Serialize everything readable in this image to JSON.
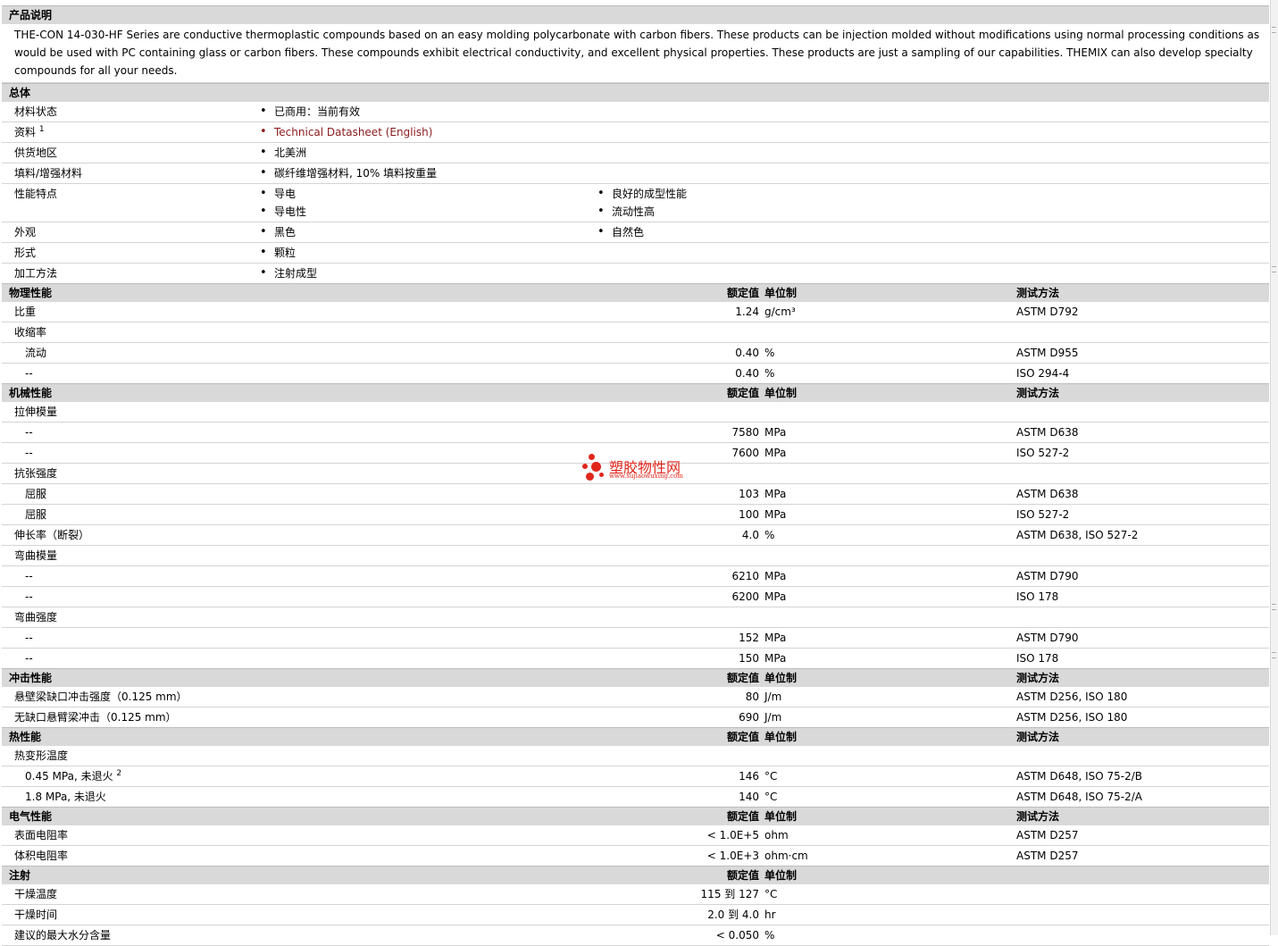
{
  "desc": {
    "title": "产品说明",
    "text": "THE-CON 14-030-HF Series are conductive thermoplastic compounds based on an easy molding polycarbonate with carbon fibers. These products can be injection molded without modifications using normal processing conditions as would be used with PC containing glass or carbon fibers. These compounds exhibit electrical conductivity, and excellent physical properties. These products are just a sampling of our capabilities. THEMIX can also develop specialty compounds for all your needs."
  },
  "general": {
    "title": "总体",
    "status_label": "材料状态",
    "status_value": "已商用：当前有效",
    "docs_label": "资料",
    "docs_sup": "1",
    "docs_link": "Technical Datasheet (English)",
    "region_label": "供货地区",
    "region_value": "北美洲",
    "filler_label": "填料/增强材料",
    "filler_value": "碳纤维增强材料, 10% 填料按重量",
    "features_label": "性能特点",
    "features": [
      "导电",
      "良好的成型性能",
      "导电性",
      "流动性高"
    ],
    "appearance_label": "外观",
    "appearance": [
      "黑色",
      "自然色"
    ],
    "form_label": "形式",
    "form_value": "颗粒",
    "process_label": "加工方法",
    "process_value": "注射成型"
  },
  "headers": {
    "value": "额定值",
    "unit": "单位制",
    "method": "测试方法"
  },
  "physical": {
    "title": "物理性能",
    "rows": [
      {
        "label": "比重",
        "value": "1.24",
        "unit": "g/cm³",
        "method": "ASTM D792"
      },
      {
        "label": "收缩率"
      },
      {
        "label": "流动",
        "value": "0.40",
        "unit": "%",
        "method": "ASTM D955"
      },
      {
        "label": "--",
        "value": "0.40",
        "unit": "%",
        "method": "ISO 294-4"
      }
    ]
  },
  "mechanical": {
    "title": "机械性能",
    "rows": [
      {
        "label": "拉伸模量"
      },
      {
        "label": "--",
        "value": "7580",
        "unit": "MPa",
        "method": "ASTM D638"
      },
      {
        "label": "--",
        "value": "7600",
        "unit": "MPa",
        "method": "ISO 527-2"
      },
      {
        "label": "抗张强度"
      },
      {
        "label": "屈服",
        "value": "103",
        "unit": "MPa",
        "method": "ASTM D638"
      },
      {
        "label": "屈服",
        "value": "100",
        "unit": "MPa",
        "method": "ISO 527-2"
      },
      {
        "label": "伸长率（断裂）",
        "value": "4.0",
        "unit": "%",
        "method": "ASTM D638, ISO 527-2"
      },
      {
        "label": "弯曲模量"
      },
      {
        "label": "--",
        "value": "6210",
        "unit": "MPa",
        "method": "ASTM D790"
      },
      {
        "label": "--",
        "value": "6200",
        "unit": "MPa",
        "method": "ISO 178"
      },
      {
        "label": "弯曲强度"
      },
      {
        "label": "--",
        "value": "152",
        "unit": "MPa",
        "method": "ASTM D790"
      },
      {
        "label": "--",
        "value": "150",
        "unit": "MPa",
        "method": "ISO 178"
      }
    ]
  },
  "impact": {
    "title": "冲击性能",
    "rows": [
      {
        "label": "悬壁梁缺口冲击强度（0.125 mm）",
        "value": "80",
        "unit": "J/m",
        "method": "ASTM D256, ISO 180"
      },
      {
        "label": "无缺口悬臂梁冲击（0.125 mm）",
        "value": "690",
        "unit": "J/m",
        "method": "ASTM D256, ISO 180"
      }
    ]
  },
  "thermal": {
    "title": "热性能",
    "rows": [
      {
        "label": "热变形温度"
      },
      {
        "label": "0.45 MPa, 未退火",
        "sup": "2",
        "value": "146",
        "unit": "°C",
        "method": "ASTM D648, ISO 75-2/B"
      },
      {
        "label": "1.8 MPa, 未退火",
        "value": "140",
        "unit": "°C",
        "method": "ASTM D648, ISO 75-2/A"
      }
    ]
  },
  "electrical": {
    "title": "电气性能",
    "rows": [
      {
        "label": "表面电阻率",
        "value": "< 1.0E+5",
        "unit": "ohm",
        "method": "ASTM D257"
      },
      {
        "label": "体积电阻率",
        "value": "< 1.0E+3",
        "unit": "ohm·cm",
        "method": "ASTM D257"
      }
    ]
  },
  "injection": {
    "title": "注射",
    "rows": [
      {
        "label": "干燥温度",
        "value": "115 到  127",
        "unit": "°C"
      },
      {
        "label": "干燥时间",
        "value": "2.0 到  4.0",
        "unit": "hr"
      },
      {
        "label": "建议的最大水分含量",
        "value": "< 0.050",
        "unit": "%"
      }
    ]
  },
  "watermark": {
    "cn": "塑胶物性网",
    "en": "www.sujiaowuxing.com"
  }
}
